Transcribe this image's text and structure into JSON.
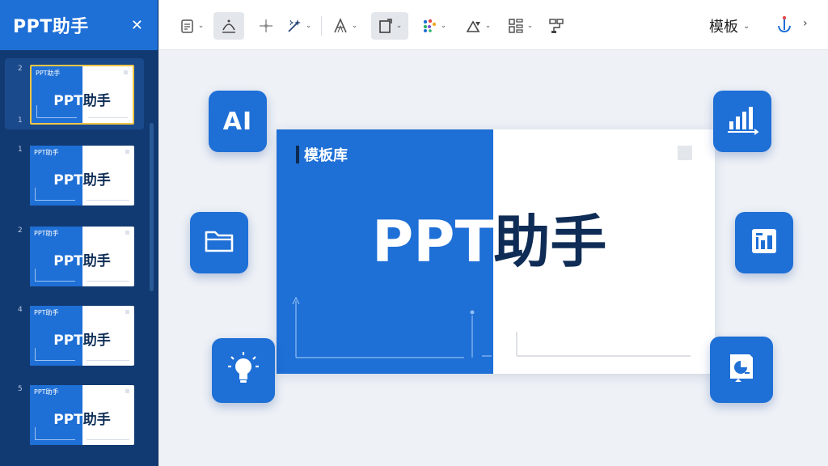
{
  "sidebar": {
    "title": "PPT助手",
    "close_glyph": "✕",
    "slides": [
      {
        "number": "2",
        "number_bottom": "1",
        "thumb_label": "PPT助手",
        "title_left": "PPT",
        "title_right": "助手",
        "active": true
      },
      {
        "number": "1",
        "thumb_label": "PPT助手",
        "title_left": "PPT",
        "title_right": "助手"
      },
      {
        "number": "2",
        "thumb_label": "PPT助手",
        "title_left": "PPT",
        "title_right": "助手"
      },
      {
        "number": "4",
        "thumb_label": "PPT助手",
        "title_left": "PPT",
        "title_right": "助手"
      },
      {
        "number": "5",
        "thumb_label": "PPT助手",
        "title_left": "PPT",
        "title_right": "助手"
      }
    ]
  },
  "toolbar": {
    "template_label": "模板",
    "caret": "⌄",
    "more_glyph": "›",
    "icons": [
      "doc-icon",
      "shape-arc-icon",
      "sparkle-icon",
      "magic-wand-icon",
      "text-style-icon",
      "layout-frame-icon",
      "color-palette-icon",
      "shape-triangle-icon",
      "grid-layout-icon",
      "connector-icon",
      "anchor-icon"
    ]
  },
  "canvas": {
    "slide": {
      "label": "模板库",
      "title_left": "PPT",
      "title_right": "助手"
    },
    "ai_label": "AI",
    "float_icons": [
      "ai-icon",
      "folder-icon",
      "lightbulb-icon",
      "bar-chart-icon",
      "report-icon",
      "pie-chart-icon"
    ]
  },
  "colors": {
    "brand_blue": "#1e6fd6",
    "sidebar_bg": "#123a72",
    "dark_navy": "#0e2c55",
    "active_border": "#f0c645",
    "canvas_bg": "#eef1f6"
  }
}
